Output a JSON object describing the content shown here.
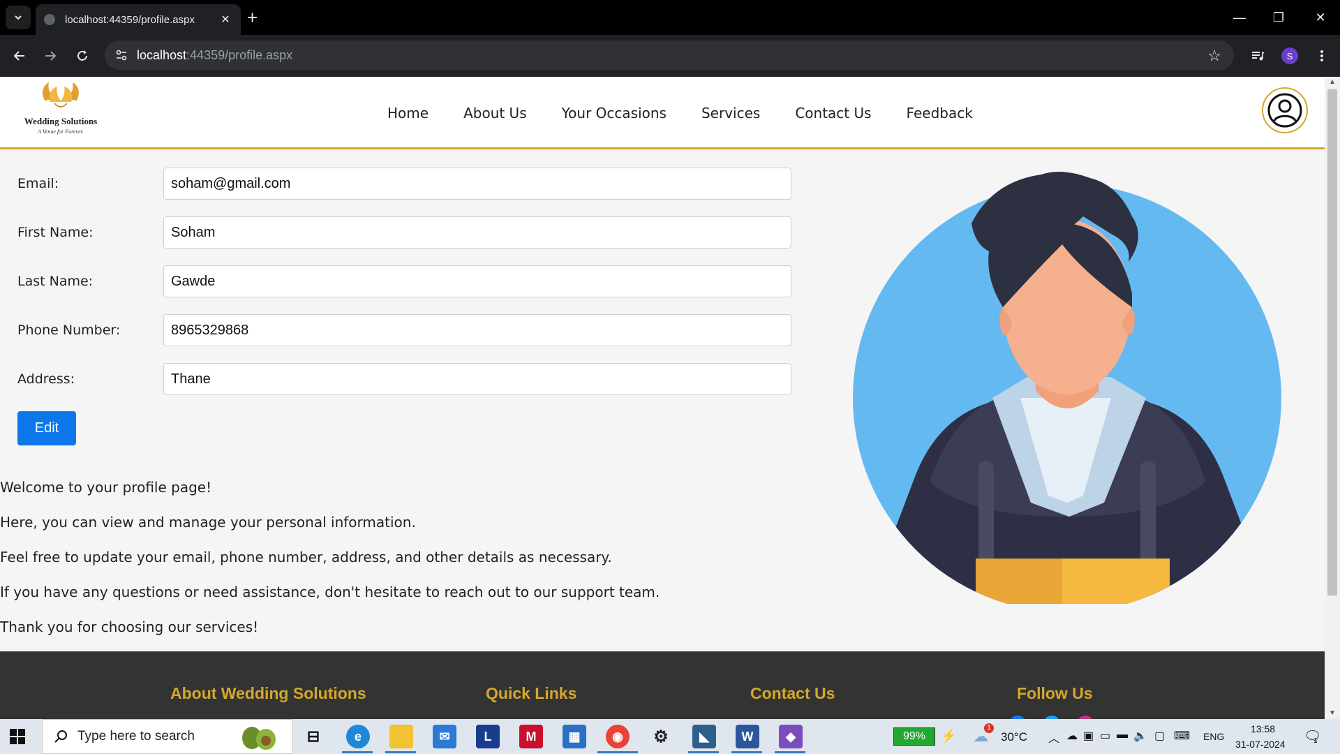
{
  "browser": {
    "tab_title": "localhost:44359/profile.aspx",
    "tab_close": "✕",
    "new_tab": "+",
    "url_host": "localhost",
    "url_rest": ":44359/profile.aspx",
    "profile_initial": "S",
    "window_controls": {
      "minimize": "—",
      "restore": "❐",
      "close": "✕"
    }
  },
  "site": {
    "logo_name": "Wedding Solutions",
    "logo_tagline": "A Venue for Forever.",
    "nav": [
      "Home",
      "About Us",
      "Your Occasions",
      "Services",
      "Contact Us",
      "Feedback"
    ]
  },
  "profile_form": {
    "fields": [
      {
        "label": "Email:",
        "value": "soham@gmail.com"
      },
      {
        "label": "First Name:",
        "value": "Soham"
      },
      {
        "label": "Last Name:",
        "value": "Gawde"
      },
      {
        "label": "Phone Number:",
        "value": "8965329868"
      },
      {
        "label": "Address:",
        "value": "Thane"
      }
    ],
    "edit_label": "Edit"
  },
  "intro": [
    "Welcome to your profile page!",
    "Here, you can view and manage your personal information.",
    "Feel free to update your email, phone number, address, and other details as necessary.",
    "If you have any questions or need assistance, don't hesitate to reach out to our support team.",
    "Thank you for choosing our services!"
  ],
  "footer": {
    "headings": [
      "About Wedding Solutions",
      "Quick Links",
      "Contact Us",
      "Follow Us"
    ]
  },
  "taskbar": {
    "search_placeholder": "Type here to search",
    "battery": "99%",
    "weather": "30°C",
    "weather_badge": "1",
    "language": "ENG",
    "time": "13:58",
    "date": "31-07-2024",
    "notification_count": "1"
  },
  "colors": {
    "accent_gold": "#d4a72c",
    "button_blue": "#0b77e9",
    "footer_bg": "#333333",
    "avatar_bg": "#64baf0"
  }
}
